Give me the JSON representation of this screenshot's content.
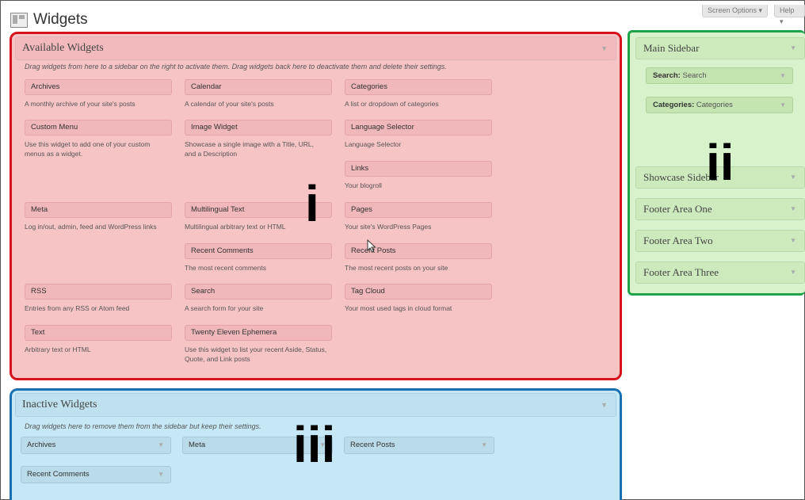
{
  "page": {
    "title": "Widgets"
  },
  "top_tabs": {
    "screen_options": "Screen Options ▾",
    "help": "Help ▾"
  },
  "available": {
    "title": "Available Widgets",
    "description": "Drag widgets from here to a sidebar on the right to activate them. Drag widgets back here to deactivate them and delete their settings.",
    "widgets": [
      {
        "name": "Archives",
        "desc": "A monthly archive of your site's posts"
      },
      {
        "name": "Calendar",
        "desc": "A calendar of your site's posts"
      },
      {
        "name": "Categories",
        "desc": "A list or dropdown of categories"
      },
      {
        "name": "Custom Menu",
        "desc": "Use this widget to add one of your custom menus as a widget."
      },
      {
        "name": "Image Widget",
        "desc": "Showcase a single image with a Title, URL, and a Description"
      },
      {
        "name": "Language Selector",
        "desc": "Language Selector"
      },
      {
        "name": "Links",
        "desc": "Your blogroll"
      },
      {
        "name": "Meta",
        "desc": "Log in/out, admin, feed and WordPress links"
      },
      {
        "name": "Multilingual Text",
        "desc": "Multilingual arbitrary text or HTML"
      },
      {
        "name": "Pages",
        "desc": "Your site's WordPress Pages"
      },
      {
        "name": "Recent Comments",
        "desc": "The most recent comments"
      },
      {
        "name": "Recent Posts",
        "desc": "The most recent posts on your site"
      },
      {
        "name": "RSS",
        "desc": "Entries from any RSS or Atom feed"
      },
      {
        "name": "Search",
        "desc": "A search form for your site"
      },
      {
        "name": "Tag Cloud",
        "desc": "Your most used tags in cloud format"
      },
      {
        "name": "Text",
        "desc": "Arbitrary text or HTML"
      },
      {
        "name": "Twenty Eleven Ephemera",
        "desc": "Use this widget to list your recent Aside, Status, Quote, and Link posts"
      }
    ]
  },
  "inactive": {
    "title": "Inactive Widgets",
    "description": "Drag widgets here to remove them from the sidebar but keep their settings.",
    "widgets": [
      "Archives",
      "Meta",
      "Recent Posts",
      "Recent Comments"
    ]
  },
  "sidebars": {
    "main": {
      "title": "Main Sidebar",
      "widgets": [
        {
          "type": "Search:",
          "title": "Search"
        },
        {
          "type": "Categories:",
          "title": "Categories"
        }
      ]
    },
    "others": [
      "Showcase Sidebar",
      "Footer Area One",
      "Footer Area Two",
      "Footer Area Three"
    ]
  },
  "annotations": {
    "i": "i",
    "ii": "ii",
    "iii": "iii"
  },
  "colors": {
    "available_border": "#d6131c",
    "inactive_border": "#1a6fb1",
    "sidebars_border": "#1fa34a"
  }
}
